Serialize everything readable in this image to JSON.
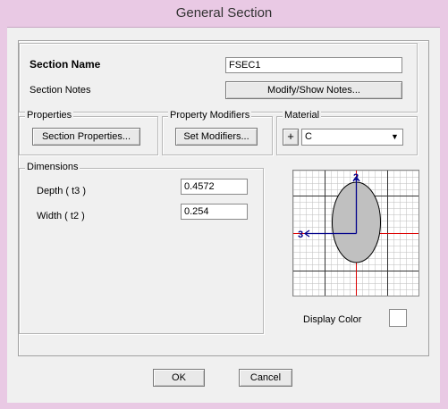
{
  "window": {
    "title": "General Section"
  },
  "section": {
    "name_label": "Section Name",
    "name_value": "FSEC1",
    "notes_label": "Section Notes",
    "notes_button": "Modify/Show Notes..."
  },
  "properties": {
    "legend": "Properties",
    "button": "Section Properties..."
  },
  "modifiers": {
    "legend": "Property Modifiers",
    "button": "Set Modifiers..."
  },
  "material": {
    "legend": "Material",
    "plus": "+",
    "value": "C"
  },
  "dimensions": {
    "legend": "Dimensions",
    "depth_label": "Depth  ( t3 )",
    "depth_value": "0.4572",
    "width_label": "Width  ( t2 )",
    "width_value": "0.254"
  },
  "preview": {
    "axis_2": "2",
    "axis_3": "3",
    "fill_color": "#c0c0c0"
  },
  "display_color": {
    "label": "Display Color",
    "color": "#ffffff"
  },
  "footer": {
    "ok": "OK",
    "cancel": "Cancel"
  }
}
